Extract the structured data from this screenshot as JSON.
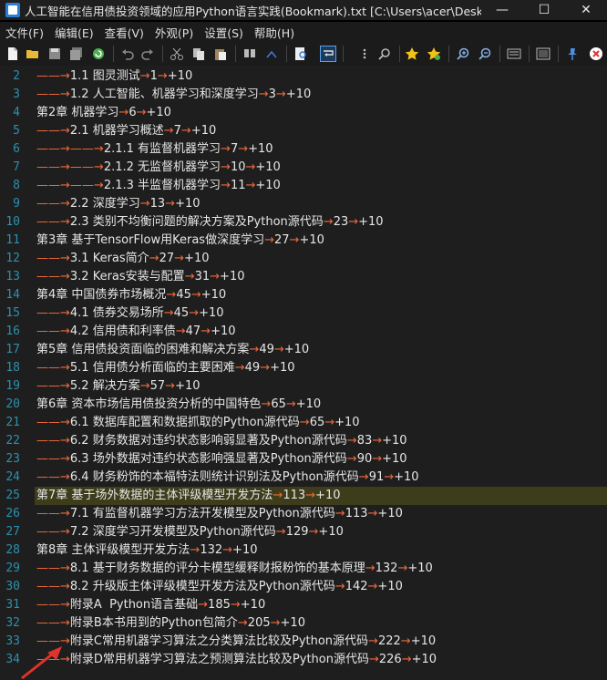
{
  "window": {
    "title": "人工智能在信用债投资领域的应用Python语言实践(Bookmark).txt [C:\\Users\\acer\\Desktop\\N...",
    "minimize": "—",
    "maximize": "☐",
    "close": "✕"
  },
  "menu": [
    "文件(F)",
    "编辑(E)",
    "查看(V)",
    "外观(P)",
    "设置(S)",
    "帮助(H)"
  ],
  "colors": {
    "line_number": "#2b91af",
    "tab_marker": "#f06a3c",
    "highlight": "#3d3d1c",
    "annotation_arrow": "#e0332a"
  },
  "lines": [
    {
      "n": "2",
      "indent": 1,
      "text": "1.1 图灵测试",
      "page": "1",
      "plus": "+10"
    },
    {
      "n": "3",
      "indent": 1,
      "text": "1.2 人工智能、机器学习和深度学习",
      "page": "3",
      "plus": "+10"
    },
    {
      "n": "4",
      "indent": 0,
      "text": "第2章 机器学习",
      "page": "6",
      "plus": "+10"
    },
    {
      "n": "5",
      "indent": 1,
      "text": "2.1 机器学习概述",
      "page": "7",
      "plus": "+10"
    },
    {
      "n": "6",
      "indent": 2,
      "text": "2.1.1 有监督机器学习",
      "page": "7",
      "plus": "+10"
    },
    {
      "n": "7",
      "indent": 2,
      "text": "2.1.2 无监督机器学习",
      "page": "10",
      "plus": "+10"
    },
    {
      "n": "8",
      "indent": 2,
      "text": "2.1.3 半监督机器学习",
      "page": "11",
      "plus": "+10"
    },
    {
      "n": "9",
      "indent": 1,
      "text": "2.2 深度学习",
      "page": "13",
      "plus": "+10"
    },
    {
      "n": "10",
      "indent": 1,
      "text": "2.3 类别不均衡问题的解决方案及Python源代码",
      "page": "23",
      "plus": "+10"
    },
    {
      "n": "11",
      "indent": 0,
      "text": "第3章 基于TensorFlow用Keras做深度学习",
      "page": "27",
      "plus": "+10"
    },
    {
      "n": "12",
      "indent": 1,
      "text": "3.1 Keras简介",
      "page": "27",
      "plus": "+10"
    },
    {
      "n": "13",
      "indent": 1,
      "text": "3.2 Keras安装与配置",
      "page": "31",
      "plus": "+10"
    },
    {
      "n": "14",
      "indent": 0,
      "text": "第4章 中国债券市场概况",
      "page": "45",
      "plus": "+10"
    },
    {
      "n": "15",
      "indent": 1,
      "text": "4.1 债券交易场所",
      "page": "45",
      "plus": "+10"
    },
    {
      "n": "16",
      "indent": 1,
      "text": "4.2 信用债和利率债",
      "page": "47",
      "plus": "+10"
    },
    {
      "n": "17",
      "indent": 0,
      "text": "第5章 信用债投资面临的困难和解决方案",
      "page": "49",
      "plus": "+10"
    },
    {
      "n": "18",
      "indent": 1,
      "text": "5.1 信用债分析面临的主要困难",
      "page": "49",
      "plus": "+10"
    },
    {
      "n": "19",
      "indent": 1,
      "text": "5.2 解决方案",
      "page": "57",
      "plus": "+10"
    },
    {
      "n": "20",
      "indent": 0,
      "text": "第6章 资本市场信用债投资分析的中国特色",
      "page": "65",
      "plus": "+10"
    },
    {
      "n": "21",
      "indent": 1,
      "text": "6.1 数据库配置和数据抓取的Python源代码",
      "page": "65",
      "plus": "+10"
    },
    {
      "n": "22",
      "indent": 1,
      "text": "6.2 财务数据对违约状态影响弱显著及Python源代码",
      "page": "83",
      "plus": "+10"
    },
    {
      "n": "23",
      "indent": 1,
      "text": "6.3 场外数据对违约状态影响强显著及Python源代码",
      "page": "90",
      "plus": "+10"
    },
    {
      "n": "24",
      "indent": 1,
      "text": "6.4 财务粉饰的本福特法则统计识别法及Python源代码",
      "page": "91",
      "plus": "+10"
    },
    {
      "n": "25",
      "indent": 0,
      "text": "第7章 基于场外数据的主体评级模型开发方法",
      "page": "113",
      "plus": "+10",
      "current": true
    },
    {
      "n": "26",
      "indent": 1,
      "text": "7.1 有监督机器学习方法开发模型及Python源代码",
      "page": "113",
      "plus": "+10"
    },
    {
      "n": "27",
      "indent": 1,
      "text": "7.2 深度学习开发模型及Python源代码",
      "page": "129",
      "plus": "+10"
    },
    {
      "n": "28",
      "indent": 0,
      "text": "第8章 主体评级模型开发方法",
      "page": "132",
      "plus": "+10"
    },
    {
      "n": "29",
      "indent": 1,
      "text": "8.1 基于财务数据的评分卡模型缓释财报粉饰的基本原理",
      "page": "132",
      "plus": "+10"
    },
    {
      "n": "30",
      "indent": 1,
      "text": "8.2 升级版主体评级模型开发方法及Python源代码",
      "page": "142",
      "plus": "+10"
    },
    {
      "n": "31",
      "indent": 1,
      "text": "附录A  Python语言基础",
      "page": "185",
      "plus": "+10"
    },
    {
      "n": "32",
      "indent": 1,
      "text": "附录B本书用到的Python包简介",
      "page": "205",
      "plus": "+10"
    },
    {
      "n": "33",
      "indent": 1,
      "text": "附录C常用机器学习算法之分类算法比较及Python源代码",
      "page": "222",
      "plus": "+10"
    },
    {
      "n": "34",
      "indent": 1,
      "text": "附录D常用机器学习算法之预测算法比较及Python源代码",
      "page": "226",
      "plus": "+10"
    }
  ]
}
